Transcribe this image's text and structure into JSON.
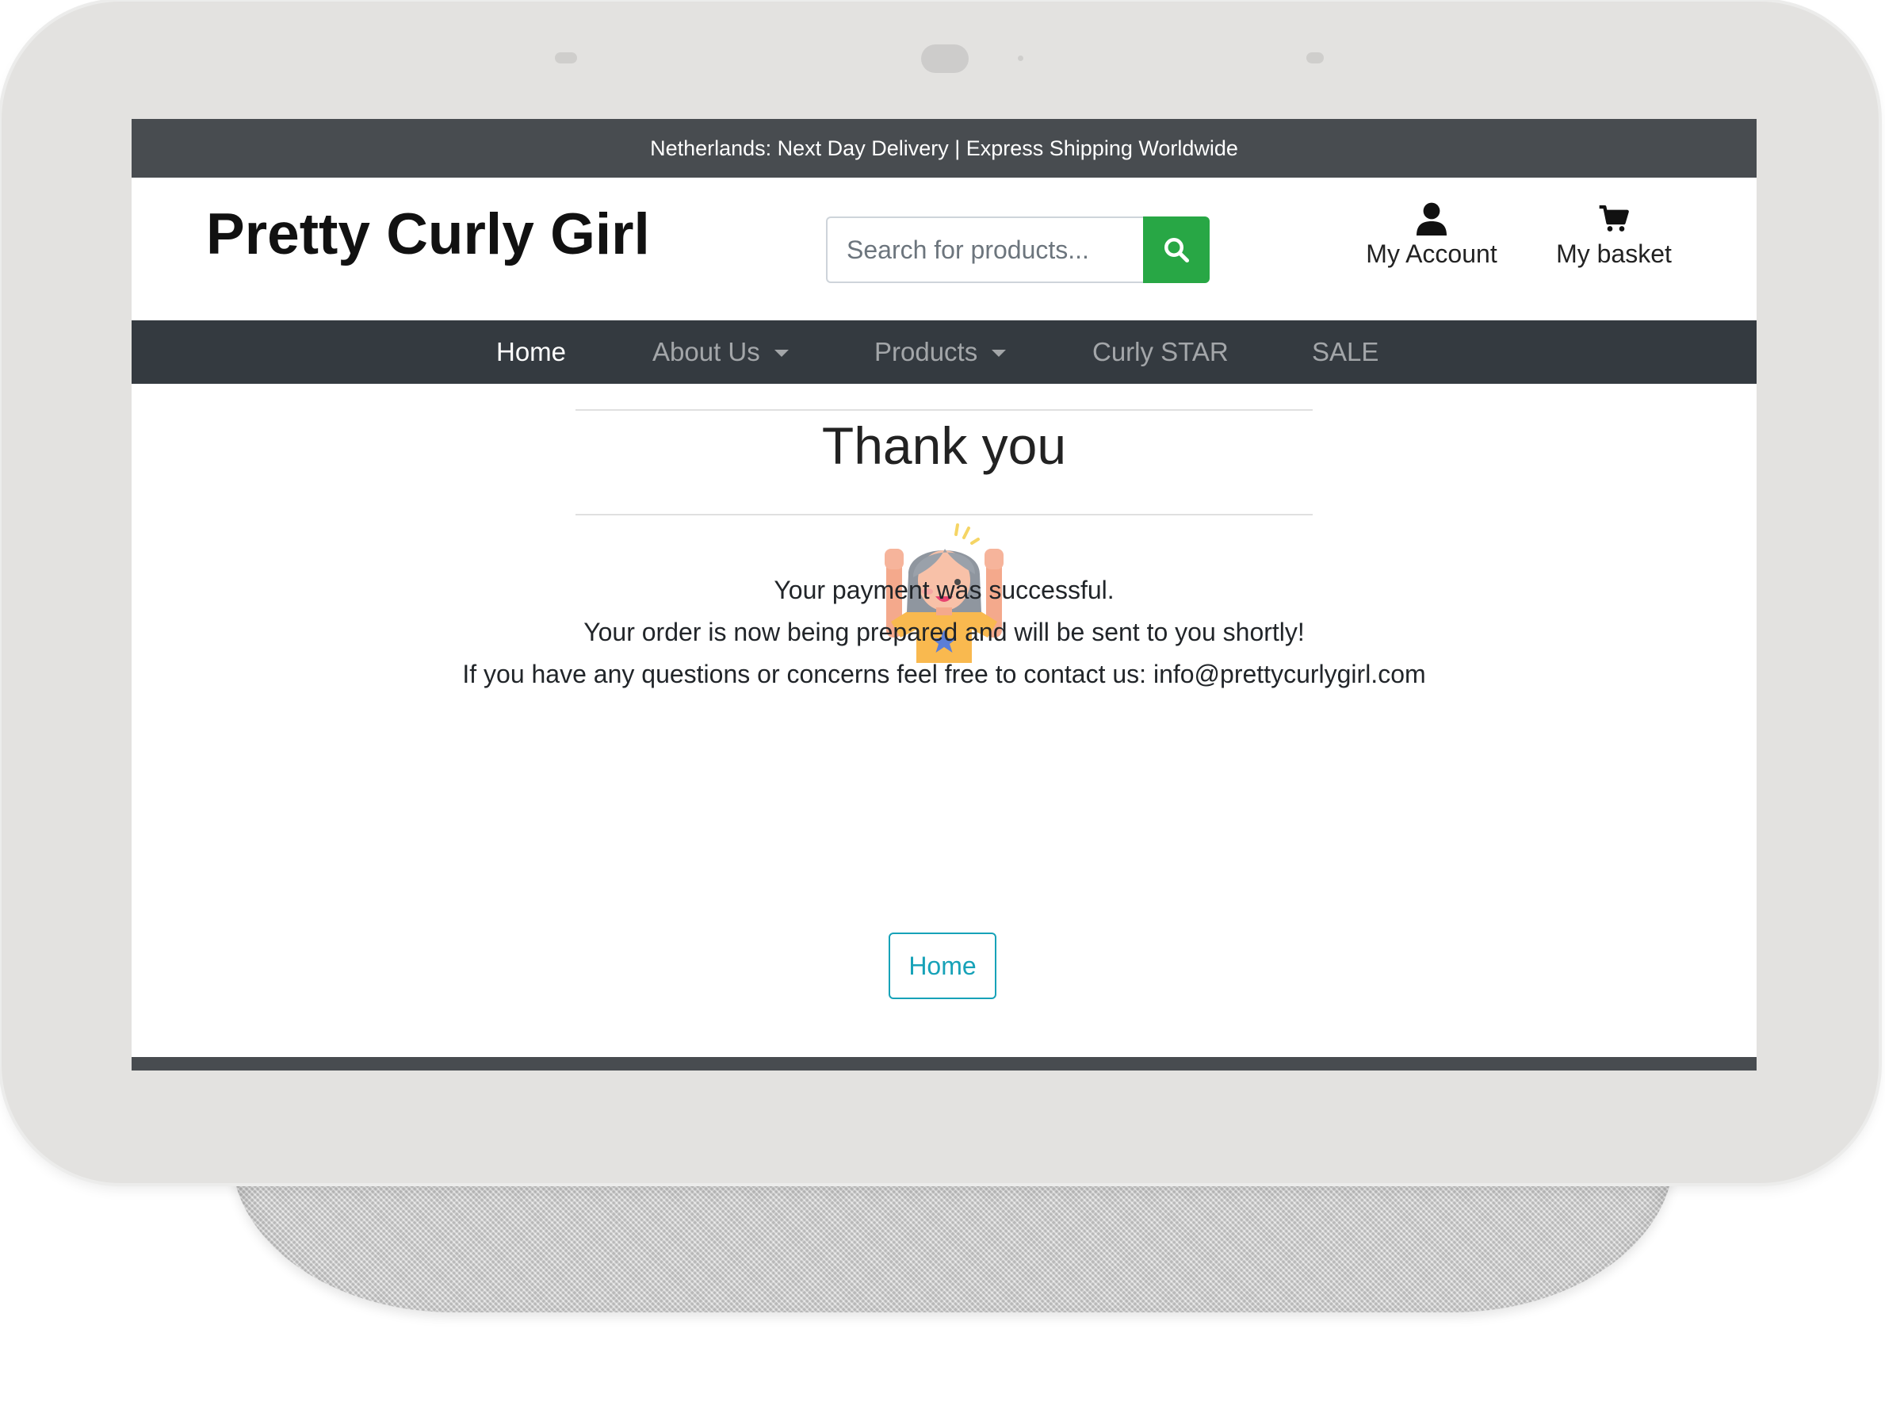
{
  "banner": {
    "text": "Netherlands: Next Day Delivery | Express Shipping Worldwide"
  },
  "header": {
    "logo": "Pretty Curly Girl",
    "search": {
      "placeholder": "Search for products...",
      "value": ""
    },
    "account_label": "My Account",
    "basket_label": "My basket"
  },
  "nav": {
    "items": [
      {
        "label": "Home"
      },
      {
        "label": "About Us"
      },
      {
        "label": "Products"
      },
      {
        "label": "Curly STAR"
      },
      {
        "label": "SALE"
      }
    ]
  },
  "main": {
    "title": "Thank you",
    "messages": [
      "Your payment was successful.",
      "Your order is now being prepared and will be sent to you shortly!",
      "If you have any questions or concerns feel free to contact us: info@prettycurlygirl.com"
    ],
    "home_button": "Home"
  },
  "icons": {
    "search": "search-icon",
    "account": "user-icon",
    "basket": "cart-icon",
    "illustration": "celebrating-girl-illustration"
  },
  "colors": {
    "banner_bg": "#484c50",
    "navbar_bg": "#343a40",
    "search_button": "#28a745",
    "home_button": "#17a2b8"
  }
}
